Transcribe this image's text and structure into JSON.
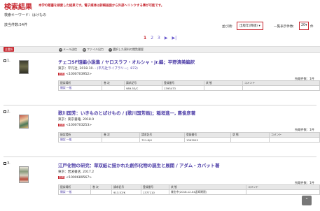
{
  "header": {
    "title": "検索結果",
    "notice": "本学の蔵書を検索した結果です。電子媒体は詳細画面から外部へリンクする事が可能です。"
  },
  "query": {
    "keyword": "検索キーワード：はけもの",
    "count": "該当件数:54件"
  },
  "controls": {
    "sort_label": "並び順:",
    "sort_value": "出版年(降順)",
    "per_page_label": "一覧表示件数:",
    "per_page_value": "20",
    "per_page_unit": "件"
  },
  "pager": {
    "pages": [
      "1",
      "2",
      "3"
    ],
    "next": "▶",
    "last": "▶|"
  },
  "toolbar": {
    "all_button": "全選択",
    "mail": "メール送信",
    "file": "ファイル出力",
    "history": "選択した資料の閲覧履歴"
  },
  "holdings_headers": [
    "配架場所",
    "巻 次",
    "請求記号",
    "登録番号",
    "状 態",
    "コメント"
  ],
  "records": [
    {
      "no": "1.",
      "title": "チェコSF短編小説集 / ヤロスラフ・オルシャ・jr.編；平野清美編訳",
      "publisher": "東京：平凡社, 2018.10. -",
      "series": "(平凡社ライブラリー；872)",
      "tag": "図書",
      "id": "<1000703952>",
      "held_count": "所蔵件数：1件",
      "holdings": [
        {
          "location": "開架 一般",
          "volume": "",
          "call_no": "989.53/C",
          "reg_no": "1393473",
          "status": "",
          "comment": ""
        }
      ]
    },
    {
      "no": "2.",
      "title": "歌川国芳：いきものとばけもの / [歌川国芳画]；稲垣進一, 悳俊彦著",
      "publisher": "東京：東京書籍, 2018.9",
      "series": "",
      "tag": "図書",
      "id": "<1000703253>",
      "held_count": "所蔵件数：1件",
      "holdings": [
        {
          "location": "開架 一般",
          "volume": "",
          "call_no": "721.8/U",
          "reg_no": "1393915",
          "status": "",
          "comment": ""
        }
      ]
    },
    {
      "no": "3.",
      "title": "江戸化物の研究：草双紙に描かれた創作化物の誕生と展開 / アダム・カバット著",
      "publisher": "東京：岩波書店, 2017.2",
      "series": "",
      "tag": "図書",
      "id": "<1000689567>",
      "held_count": "所蔵件数：1件",
      "holdings": [
        {
          "location": "開架 一般",
          "volume": "",
          "call_no": "913.57/K",
          "reg_no": "1377110",
          "status": "貸出中(2018.12.04返却期限)",
          "comment": ""
        }
      ]
    }
  ],
  "colors": {
    "accent": "#c6262e",
    "link": "#4a3aa6"
  }
}
